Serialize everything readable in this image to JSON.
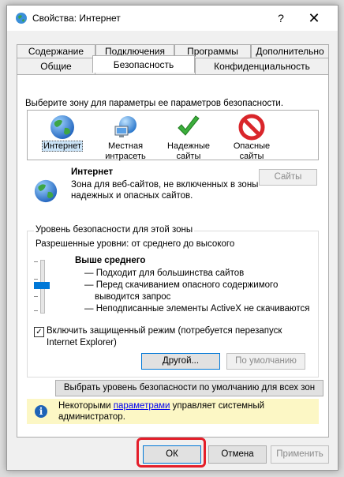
{
  "window": {
    "title": "Свойства: Интернет",
    "help": "?",
    "close": "✕"
  },
  "tabs": {
    "row1": [
      "Содержание",
      "Подключения",
      "Программы",
      "Дополнительно"
    ],
    "row2": [
      "Общие",
      "Безопасность",
      "Конфиденциальность"
    ]
  },
  "zone_prompt": "Выберите зону для параметры ее параметров безопасности.",
  "zones": [
    {
      "line1": "Интернет",
      "line2": "",
      "icon": "globe-icon"
    },
    {
      "line1": "Местная",
      "line2": "интрасеть",
      "icon": "intranet-icon"
    },
    {
      "line1": "Надежные",
      "line2": "сайты",
      "icon": "checkmark-icon"
    },
    {
      "line1": "Опасные",
      "line2": "сайты",
      "icon": "prohibited-icon"
    }
  ],
  "selected_zone": {
    "name": "Интернет",
    "desc1": "Зона для веб-сайтов, не включенных в зоны",
    "desc2": "надежных и опасных сайтов.",
    "sites_button": "Сайты"
  },
  "security_level": {
    "group_title": "Уровень безопасности для этой зоны",
    "allowed": "Разрешенные уровни: от среднего до высокого",
    "level": "Выше среднего",
    "items": [
      "— Подходит для большинства сайтов",
      "— Перед скачиванием опасного содержимого",
      "   выводится запрос",
      "— Неподписанные элементы ActiveX не скачиваются"
    ],
    "protected_mode_line1": "Включить защищенный режим (потребуется перезапуск",
    "protected_mode_line2": "Internet Explorer)",
    "protected_mode_checked": true,
    "other_button": "Другой...",
    "default_button": "По умолчанию"
  },
  "reset_all_button": "Выбрать уровень безопасности по умолчанию для всех зон",
  "notice": {
    "before": "Некоторыми ",
    "link": "параметрами",
    "after": " управляет системный",
    "line2": "администратор."
  },
  "footer": {
    "ok": "ОК",
    "cancel": "Отмена",
    "apply": "Применить"
  },
  "colors": {
    "accent": "#0078d7",
    "highlight": "#e41e2a",
    "notice_bg": "#fcf7c5"
  }
}
